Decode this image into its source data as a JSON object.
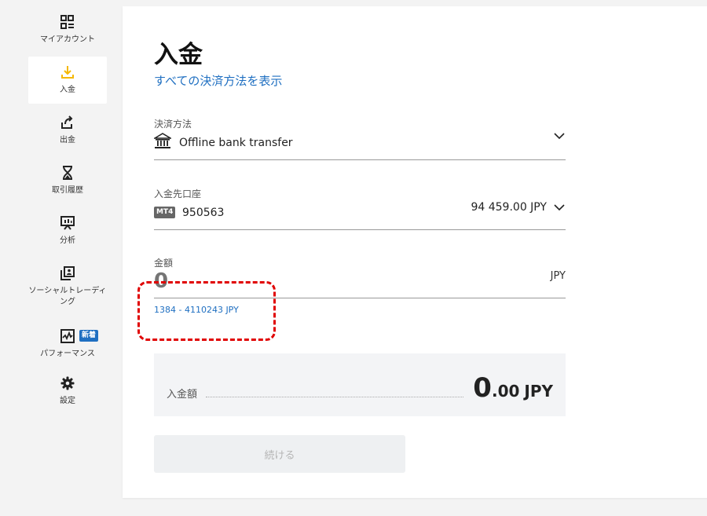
{
  "sidebar": {
    "items": [
      {
        "label": "マイアカウント",
        "icon": "grid-list-icon"
      },
      {
        "label": "入金",
        "icon": "download-icon",
        "active": true
      },
      {
        "label": "出金",
        "icon": "upload-arrow-icon"
      },
      {
        "label": "取引履歴",
        "icon": "hourglass-icon"
      },
      {
        "label": "分析",
        "icon": "analytics-board-icon"
      },
      {
        "label": "ソーシャルトレーディング",
        "icon": "social-copy-icon"
      },
      {
        "label": "パフォーマンス",
        "icon": "performance-chart-icon",
        "badge": "新着"
      },
      {
        "label": "設定",
        "icon": "gear-icon"
      }
    ]
  },
  "main": {
    "title": "入金",
    "all_methods_link": "すべての決済方法を表示",
    "payment_method": {
      "label": "決済方法",
      "value": "Offline bank transfer"
    },
    "account": {
      "label": "入金先口座",
      "platform_badge": "MT4",
      "number": "950563",
      "balance": "94 459.00 JPY"
    },
    "amount": {
      "label": "金額",
      "placeholder": "0",
      "currency": "JPY",
      "range": "1384 - 4110243 JPY"
    },
    "summary": {
      "label": "入金額",
      "integer": "0",
      "decimal": ".00",
      "currency": "JPY"
    },
    "continue_label": "続ける"
  },
  "colors": {
    "accent": "#1f6fc1",
    "active_icon": "#f5b800",
    "highlight": "#e00000",
    "panel_bg": "#ffffff",
    "page_bg": "#f3f3f3"
  }
}
